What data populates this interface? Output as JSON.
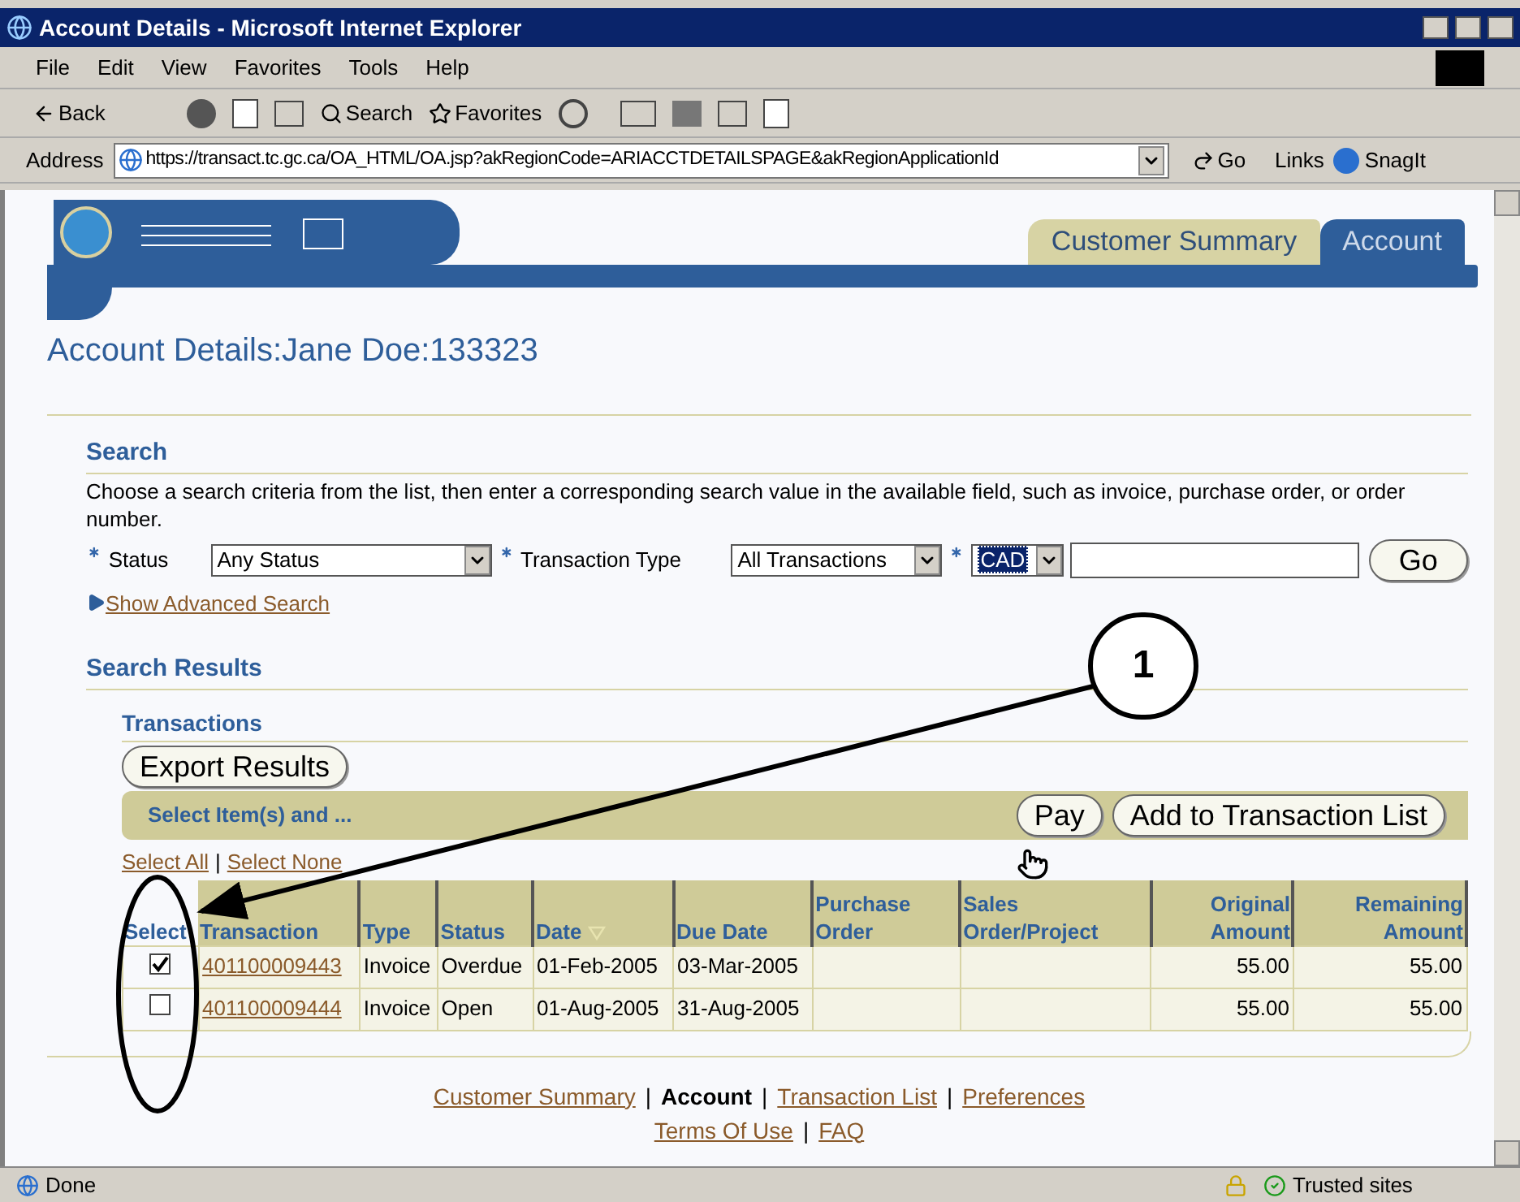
{
  "window": {
    "title": "Account Details - Microsoft Internet Explorer"
  },
  "menu": [
    "File",
    "Edit",
    "View",
    "Favorites",
    "Tools",
    "Help"
  ],
  "toolbar": {
    "back": "Back",
    "search": "Search",
    "favorites": "Favorites"
  },
  "address_bar": {
    "label": "Address",
    "url": "https://transact.tc.gc.ca/OA_HTML/OA.jsp?akRegionCode=ARIACCTDETAILSPAGE&akRegionApplicationId",
    "go": "Go",
    "links": "Links",
    "snagit": "SnagIt"
  },
  "tabs": [
    {
      "label": "Customer Summary",
      "selected": false
    },
    {
      "label": "Account",
      "selected": true
    }
  ],
  "heading": "Account Details:Jane Doe:133323",
  "search": {
    "title": "Search",
    "instructions": "Choose a search criteria from the list, then enter a corresponding search value in the available field, such as invoice, purchase order, or order number.",
    "status": {
      "label": "Status",
      "value": "Any Status"
    },
    "transaction_type": {
      "label": "Transaction Type",
      "value": "All Transactions"
    },
    "currency": {
      "value": "CAD"
    },
    "go": "Go",
    "advanced": "Show Advanced Search"
  },
  "results": {
    "title": "Search Results",
    "subtitle": "Transactions",
    "export": "Export Results",
    "action_label": "Select Item(s) and ...",
    "actions": [
      "Pay",
      "Add to Transaction List"
    ],
    "select_all": "Select All",
    "select_none": "Select None",
    "separator": "|",
    "columns": [
      {
        "label": "Select",
        "sorted": false
      },
      {
        "label": "Transaction",
        "sorted": false
      },
      {
        "label": "Type",
        "sorted": false
      },
      {
        "label": "Status",
        "sorted": false
      },
      {
        "label": "Date",
        "sorted": true
      },
      {
        "label": "Due Date",
        "sorted": false
      },
      {
        "label": "Purchase Order",
        "sorted": false
      },
      {
        "label": "Sales Order/Project",
        "sorted": false
      },
      {
        "label": "Original Amount",
        "sorted": false
      },
      {
        "label": "Remaining Amount",
        "sorted": false
      }
    ],
    "rows": [
      {
        "selected": true,
        "transaction": "401100009443",
        "type": "Invoice",
        "status": "Overdue",
        "date": "01-Feb-2005",
        "due_date": "03-Mar-2005",
        "original": "55.00",
        "remaining": "55.00"
      },
      {
        "selected": false,
        "transaction": "401100009444",
        "type": "Invoice",
        "status": "Open",
        "date": "01-Aug-2005",
        "due_date": "31-Aug-2005",
        "original": "55.00",
        "remaining": "55.00"
      }
    ]
  },
  "footer": {
    "separator": "|",
    "links": [
      {
        "label": "Customer Summary",
        "current": false
      },
      {
        "label": "Account",
        "current": true
      },
      {
        "label": "Transaction List",
        "current": false
      },
      {
        "label": "Preferences",
        "current": false
      }
    ],
    "links_2": [
      {
        "label": "Terms Of Use",
        "current": false
      },
      {
        "label": "FAQ",
        "current": false
      }
    ]
  },
  "status_bar": {
    "text": "Done",
    "zone": "Trusted sites"
  },
  "callout": {
    "label": "1"
  }
}
